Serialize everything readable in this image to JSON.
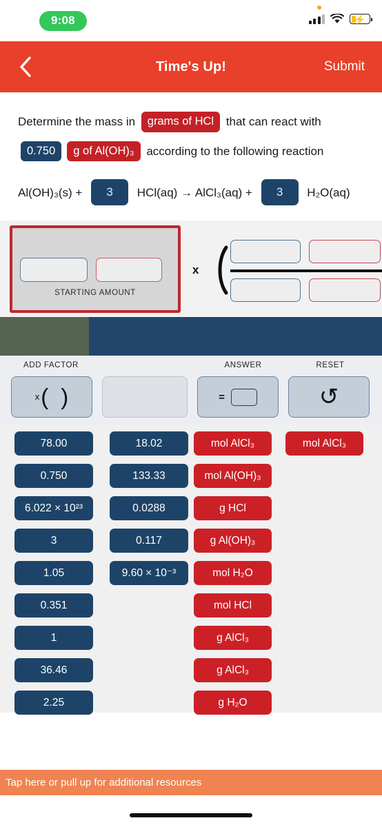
{
  "status_bar": {
    "time": "9:08",
    "icons": [
      "orange-dot-icon",
      "cellular-signal-icon",
      "wifi-icon",
      "battery-charging-icon"
    ]
  },
  "nav": {
    "back_icon": "chevron-left-icon",
    "title": "Time's Up!",
    "submit_label": "Submit"
  },
  "question": {
    "line1_a": "Determine the mass in ",
    "line1_chip": "grams of HCl",
    "line1_b": " that can react with",
    "line2_chip_value": "0.750",
    "line2_chip_unit": "g of Al(OH)₃",
    "line2_b": " according to the following reaction",
    "equation": {
      "reactant1": "Al(OH)₃(s) + ",
      "coef1": "3",
      "reactant2": " HCl(aq) → AlCl₃(aq) + ",
      "coef2": "3",
      "product2": " H₂O(aq)"
    }
  },
  "work_area": {
    "starting_amount_label": "STARTING AMOUNT",
    "start_value_slot": "",
    "start_unit_slot": "",
    "multiply_symbol": "x",
    "open_paren": "(",
    "numerator_value_slot": "",
    "numerator_unit_slot": "",
    "denominator_value_slot": "",
    "denominator_unit_slot": ""
  },
  "scroll_indicator": {
    "left_color": "#566350",
    "right_color": "#22466b"
  },
  "toolbar": {
    "add_factor_label": "ADD FACTOR",
    "add_factor_icon": "x-parentheses-icon",
    "answer_label": "ANSWER",
    "answer_equals": "=",
    "reset_label": "RESET",
    "reset_icon": "undo-arrow-icon"
  },
  "tiles": {
    "column1": [
      "78.00",
      "0.750",
      "6.022 × 10²³",
      "3",
      "1.05",
      "0.351",
      "1",
      "36.46",
      "2.25"
    ],
    "column2": [
      "18.02",
      "133.33",
      "0.0288",
      "0.117",
      "9.60 × 10⁻³"
    ],
    "column3": [
      "mol AlCl₃",
      "mol Al(OH)₃",
      "g HCl",
      "g Al(OH)₃",
      "mol H₂O",
      "mol HCl",
      "g AlCl₃",
      "g AlCl₃",
      "g H₂O"
    ],
    "column4": [
      "mol AlCl₃"
    ]
  },
  "bottom": {
    "resources_label": "Tap here or pull up for additional resources"
  },
  "colors": {
    "nav_red": "#e8402a",
    "chip_red": "#c42127",
    "chip_navy": "#1d4468",
    "tile_navy": "#1d4468",
    "tile_red": "#cc2027",
    "resources_orange": "#ef8352",
    "clock_green": "#34c759"
  }
}
